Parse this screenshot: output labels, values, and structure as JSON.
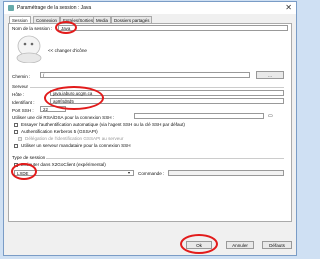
{
  "window": {
    "title": "Paramétrage de la session : Java",
    "close": "✕"
  },
  "tabs": [
    "Session",
    "Connexion",
    "Entrées/Sorties",
    "Media",
    "Dossiers partagés"
  ],
  "session": {
    "name_label": "Nom de la session :",
    "name_value": "Java",
    "change_icon_text": "<< changer d'icône"
  },
  "path": {
    "label": "Chemin :",
    "value": "/",
    "browse": "..."
  },
  "server": {
    "section": "Serveur",
    "host_label": "Hôte :",
    "host_value": "java.iaburo.ucgm.ca",
    "login_label": "Identifiant :",
    "login_value": "ap9f4d8d5",
    "port_label": "Port SSH :",
    "port_value": "22",
    "rsa_label": "Utiliser une clé RSA/DSA pour la connexion SSH :",
    "opt1": "Essayer l'authentification automatique (via l'agent SSH ou la clé SSH par défaut)",
    "opt2": "Authentification Kerberos 5 (GSSAPI)",
    "opt3": "Délégation de l'identification GSSAPI au serveur",
    "opt4": "Utiliser un serveur mandataire pour la connexion SSH"
  },
  "session_type": {
    "section": "Type de session",
    "run_label": "Exécuter dans X2GoClient (expérimental)",
    "type_value": "LXDE",
    "command_label": "Commande :"
  },
  "buttons": {
    "ok": "Ok",
    "cancel": "Annuler",
    "defaults": "Défauts"
  },
  "colors": {
    "annotation": "#e21b1b",
    "accent": "#7a9cc6"
  }
}
